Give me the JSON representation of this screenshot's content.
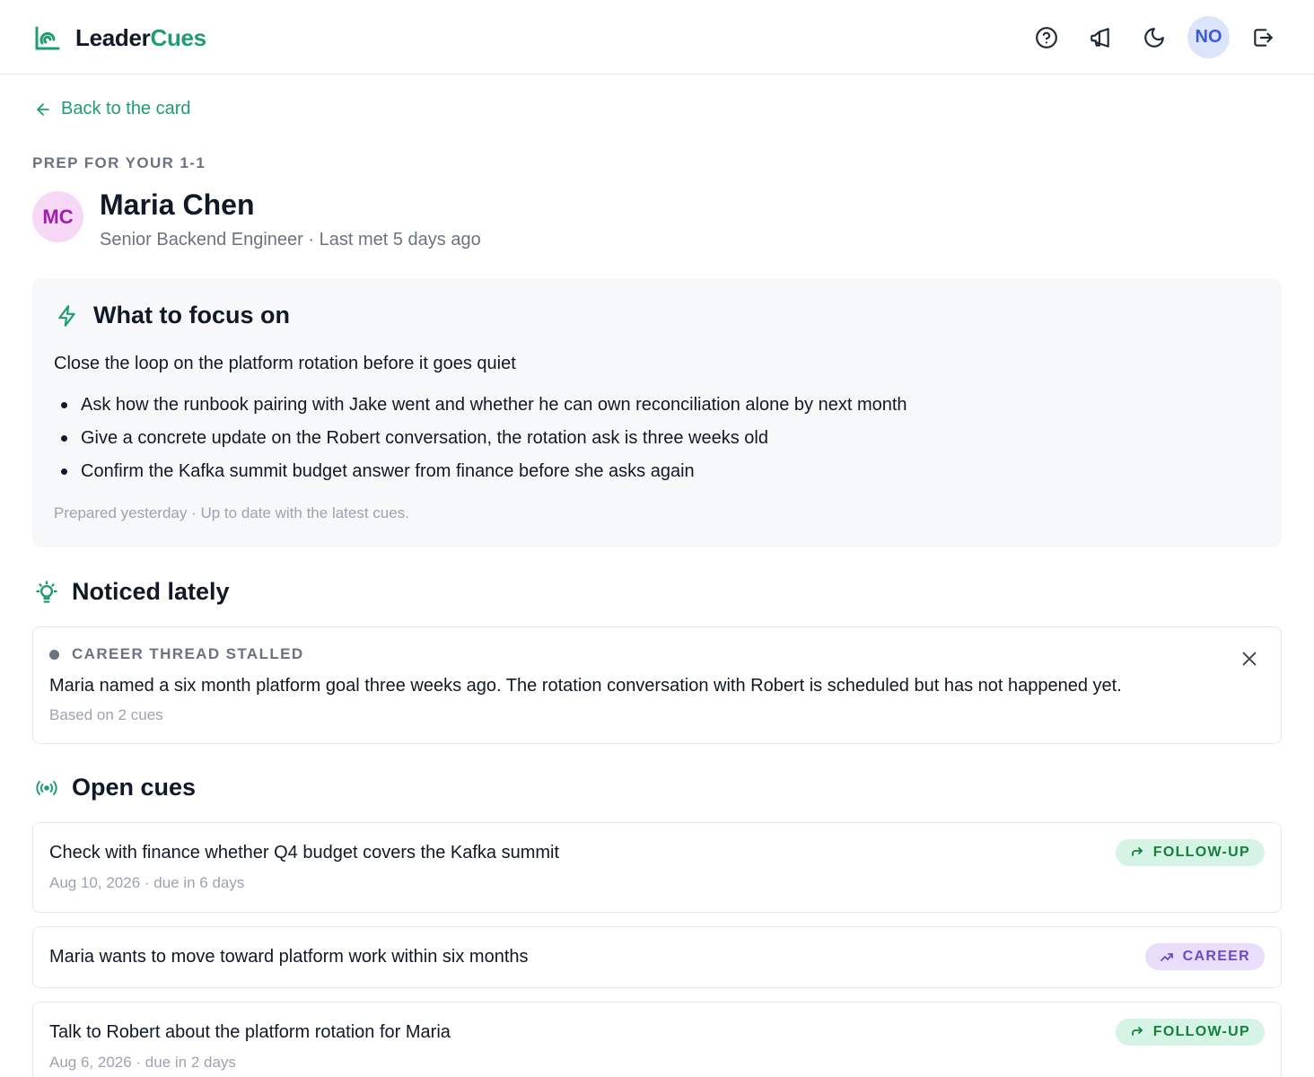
{
  "header": {
    "brand_part1": "Leader",
    "brand_part2": "Cues",
    "brand_color": "#1f9d6e",
    "icons": [
      "help-icon",
      "announcements-icon",
      "dark-mode-icon",
      "logout-icon"
    ],
    "user_initials": "NO"
  },
  "nav": {
    "back_label": "Back to the card"
  },
  "person": {
    "eyebrow": "PREP FOR YOUR 1-1",
    "initials": "MC",
    "name": "Maria Chen",
    "subtitle": "Senior Backend Engineer · Last met 5 days ago"
  },
  "focus": {
    "title": "What to focus on",
    "lead": "Close the loop on the platform rotation before it goes quiet",
    "items": [
      "Ask how the runbook pairing with Jake went and whether he can own reconciliation alone by next month",
      "Give a concrete update on the Robert conversation, the rotation ask is three weeks old",
      "Confirm the Kafka summit budget answer from finance before she asks again"
    ],
    "meta": "Prepared yesterday · Up to date with the latest cues."
  },
  "noticed": {
    "title": "Noticed lately",
    "card": {
      "label": "CAREER THREAD STALLED",
      "text": "Maria named a six month platform goal three weeks ago. The rotation conversation with Robert is scheduled but has not happened yet.",
      "meta": "Based on 2 cues"
    }
  },
  "open_cues": {
    "title": "Open cues",
    "items": [
      {
        "text": "Check with finance whether Q4 budget covers the Kafka summit",
        "meta": "Aug 10, 2026 · due in 6 days",
        "tag": "FOLLOW-UP"
      },
      {
        "text": "Maria wants to move toward platform work within six months",
        "meta": "",
        "tag": "CAREER"
      },
      {
        "text": "Talk to Robert about the platform rotation for Maria",
        "meta": "Aug 6, 2026 · due in 2 days",
        "tag": "FOLLOW-UP"
      }
    ]
  }
}
